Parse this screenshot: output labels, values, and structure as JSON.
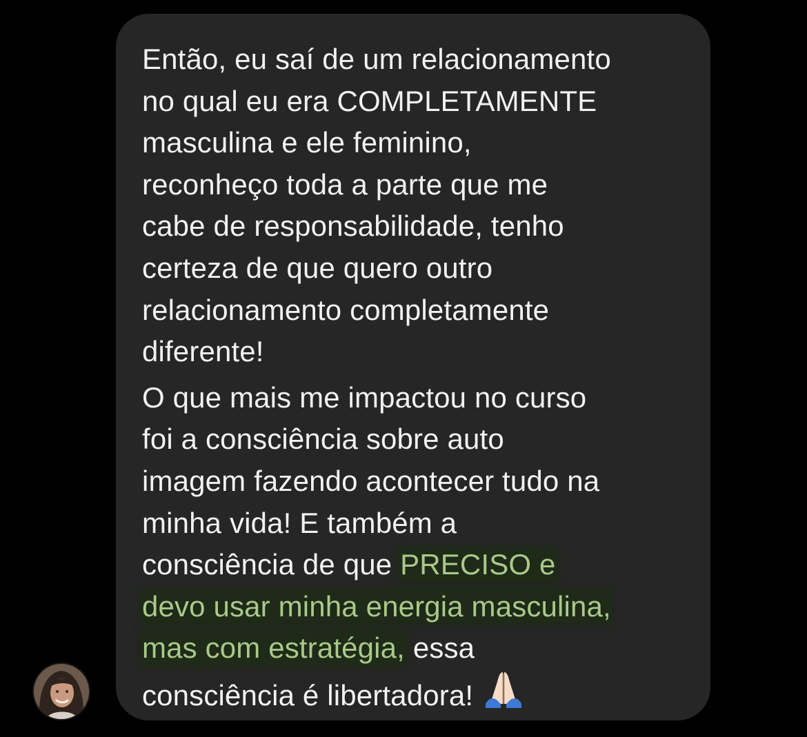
{
  "conversation": {
    "message": {
      "paragraph1": {
        "lines": [
          "Então, eu saí de um relacionamento",
          "no qual eu era COMPLETAMENTE",
          "masculina e ele feminino,",
          "reconheço toda a parte que me",
          "cabe de responsabilidade, tenho",
          "certeza de que quero outro",
          "relacionamento completamente",
          "diferente!"
        ]
      },
      "paragraph2": {
        "lines": [
          "O que mais me impactou no curso",
          "foi a consciência sobre auto",
          "imagem fazendo acontecer tudo na",
          "minha vida! E também a"
        ],
        "line5_plain": "consciência de que ",
        "line5_highlight": "PRECISO e",
        "line6_highlight": "devo usar minha energia masculina,",
        "line7_highlight": "mas com estratégia,",
        "line7_plain": " essa",
        "line8_plain": "consciência é libertadora!",
        "emoji": "praying-hands-emoji"
      }
    },
    "sender": {
      "avatar": "profile-photo"
    }
  },
  "colors": {
    "background": "#000000",
    "bubble": "#262626",
    "text": "#f2f2f2",
    "highlight_text": "#a9c98a",
    "highlight_bg": "#1f2a18"
  }
}
